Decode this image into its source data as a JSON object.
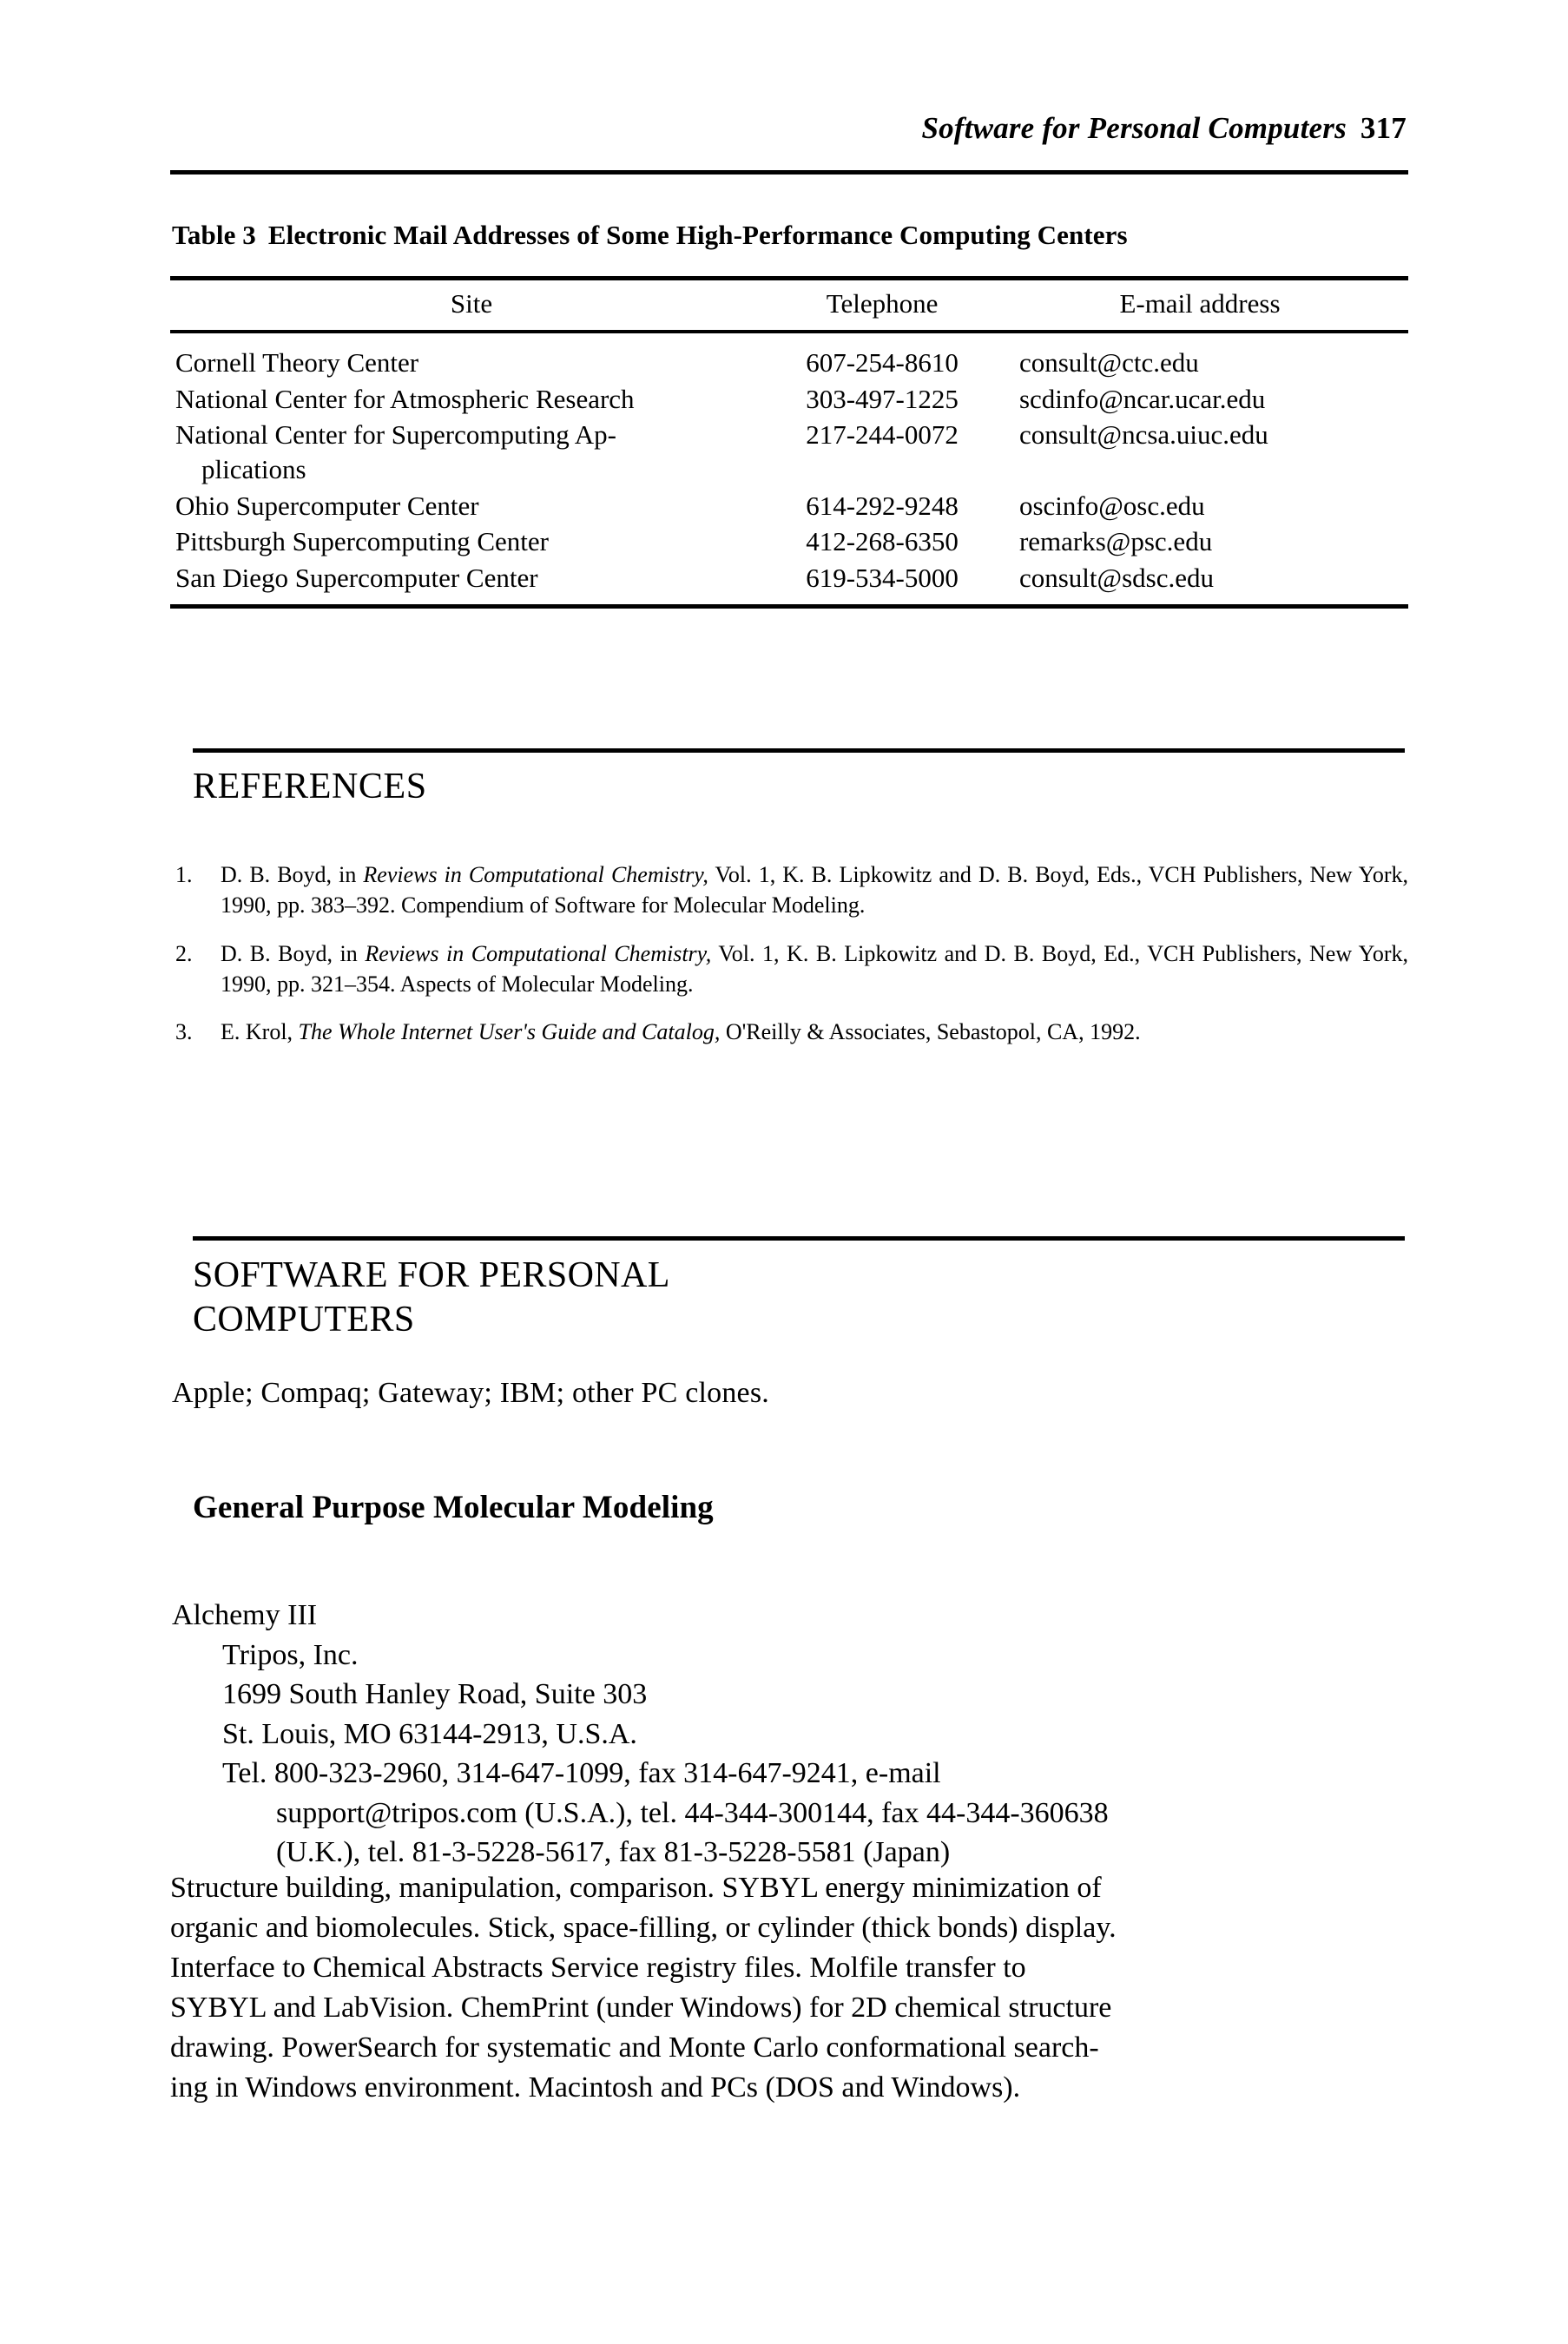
{
  "running_head": {
    "title": "Software for Personal Computers",
    "page_number": "317"
  },
  "table": {
    "caption_number": "Table 3",
    "caption_text": "Electronic Mail Addresses of Some High-Performance Computing Centers",
    "columns": [
      "Site",
      "Telephone",
      "E-mail address"
    ],
    "rows": [
      {
        "site": "Cornell Theory Center",
        "site_cont": "",
        "telephone": "607-254-8610",
        "email": "consult@ctc.edu"
      },
      {
        "site": "National Center for Atmospheric Research",
        "site_cont": "",
        "telephone": "303-497-1225",
        "email": "scdinfo@ncar.ucar.edu"
      },
      {
        "site": "National Center for Supercomputing Ap-",
        "site_cont": "plications",
        "telephone": "217-244-0072",
        "email": "consult@ncsa.uiuc.edu"
      },
      {
        "site": "Ohio Supercomputer Center",
        "site_cont": "",
        "telephone": "614-292-9248",
        "email": "oscinfo@osc.edu"
      },
      {
        "site": "Pittsburgh Supercomputing Center",
        "site_cont": "",
        "telephone": "412-268-6350",
        "email": "remarks@psc.edu"
      },
      {
        "site": "San Diego Supercomputer Center",
        "site_cont": "",
        "telephone": "619-534-5000",
        "email": "consult@sdsc.edu"
      }
    ]
  },
  "references": {
    "heading": "REFERENCES",
    "items": [
      {
        "number": "1.",
        "part1": "D. B. Boyd, in ",
        "italic": "Reviews in Computational Chemistry,",
        "part2": " Vol. 1, K. B. Lipkowitz and D. B. Boyd, Eds., VCH Publishers, New York, 1990, pp. 383–392. Compendium of Software for Molecular Modeling."
      },
      {
        "number": "2.",
        "part1": "D. B. Boyd, in ",
        "italic": "Reviews in Computational Chemistry,",
        "part2": " Vol. 1, K. B. Lipkowitz and D. B. Boyd, Ed., VCH Publishers, New York, 1990, pp. 321–354. Aspects of Molecular Modeling."
      },
      {
        "number": "3.",
        "part1": "E. Krol, ",
        "italic": "The Whole Internet User's Guide and Catalog,",
        "part2": " O'Reilly & Associates, Sebastopol, CA, 1992."
      }
    ]
  },
  "section": {
    "heading_line1": "SOFTWARE FOR PERSONAL",
    "heading_line2": "COMPUTERS",
    "platforms": "Apple; Compaq; Gateway; IBM; other PC clones.",
    "subheading": "General Purpose Molecular Modeling"
  },
  "entry": {
    "name": "Alchemy III",
    "company": "Tripos, Inc.",
    "street": "1699 South Hanley Road, Suite 303",
    "city": "St. Louis, MO 63144-2913, U.S.A.",
    "contact_line1": "Tel. 800-323-2960, 314-647-1099, fax 314-647-9241, e-mail",
    "contact_line2": "support@tripos.com (U.S.A.), tel. 44-344-300144, fax 44-344-360638",
    "contact_line3": "(U.K.), tel. 81-3-5228-5617, fax 81-3-5228-5581 (Japan)",
    "description_lines": [
      "Structure building, manipulation, comparison. SYBYL energy minimization of",
      "organic and biomolecules. Stick, space-filling, or cylinder (thick bonds) display.",
      "Interface to Chemical Abstracts Service registry files. Molfile transfer to",
      "SYBYL and LabVision. ChemPrint (under Windows) for 2D chemical structure",
      "drawing. PowerSearch for systematic and Monte Carlo conformational search-",
      "ing in Windows environment. Macintosh and PCs (DOS and Windows)."
    ]
  }
}
